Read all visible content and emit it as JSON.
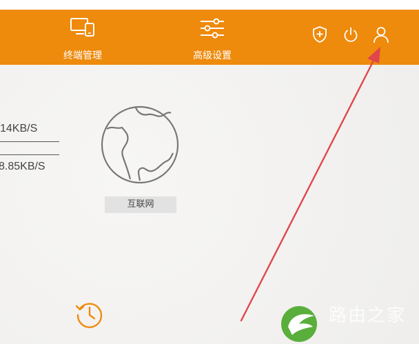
{
  "header": {
    "nav": [
      {
        "label": "终端管理",
        "icon": "devices-icon"
      },
      {
        "label": "高级设置",
        "icon": "sliders-icon"
      }
    ],
    "actions": [
      "shield-plus-icon",
      "power-icon",
      "user-icon"
    ],
    "background_color": "#ee8a0c"
  },
  "main": {
    "upload_speed": "14KB/S",
    "download_speed": "8.85KB/S",
    "internet_label": "互联网",
    "history_icon": "history-icon",
    "annotation_color": "#e0464b",
    "watermark": {
      "text": "路由之家",
      "logo": "leaf-logo"
    }
  }
}
